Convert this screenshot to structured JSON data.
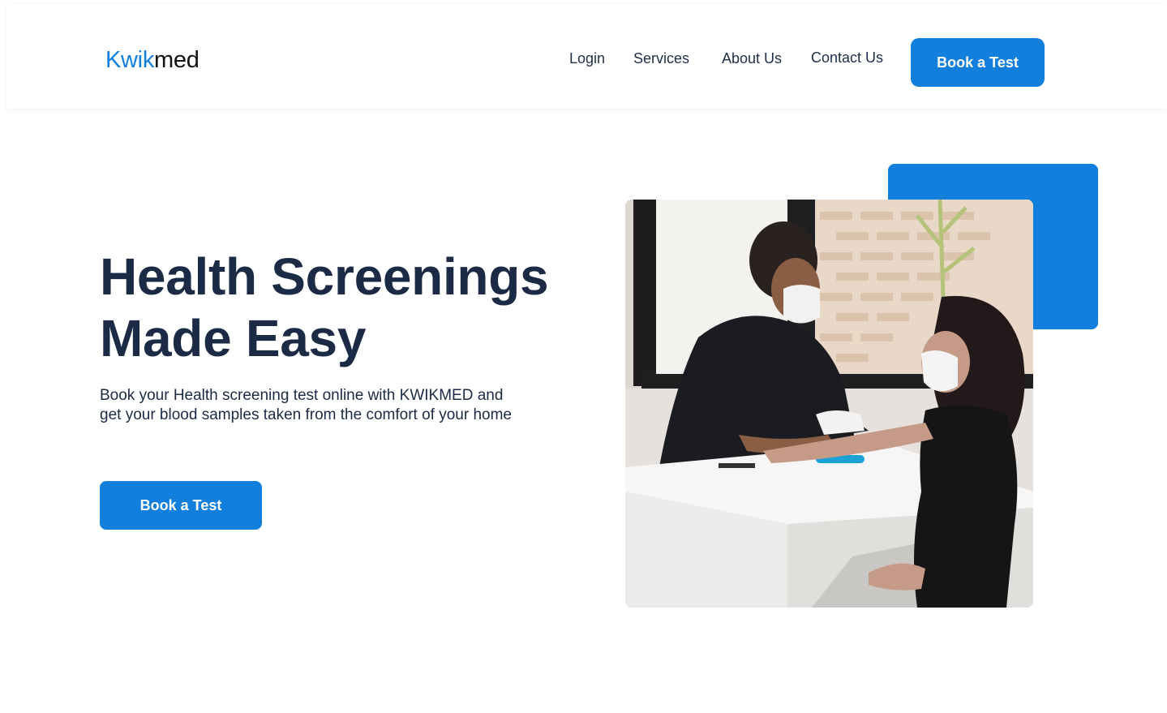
{
  "brand": {
    "logo_part1": "Kwik",
    "logo_part2": "med"
  },
  "nav": {
    "login": "Login",
    "services": "Services",
    "about": "About Us",
    "contact": "Contact Us",
    "cta": "Book a Test"
  },
  "hero": {
    "title_line1": "Health Screenings",
    "title_line2": "Made Easy",
    "subtitle": "Book your Health screening test online with KWIKMED and get your blood samples taken from the comfort of your home",
    "cta": "Book a Test"
  },
  "icons": {
    "photo": "blood-test-photo"
  },
  "colors": {
    "accent": "#137fdd",
    "text": "#1c2b45"
  }
}
